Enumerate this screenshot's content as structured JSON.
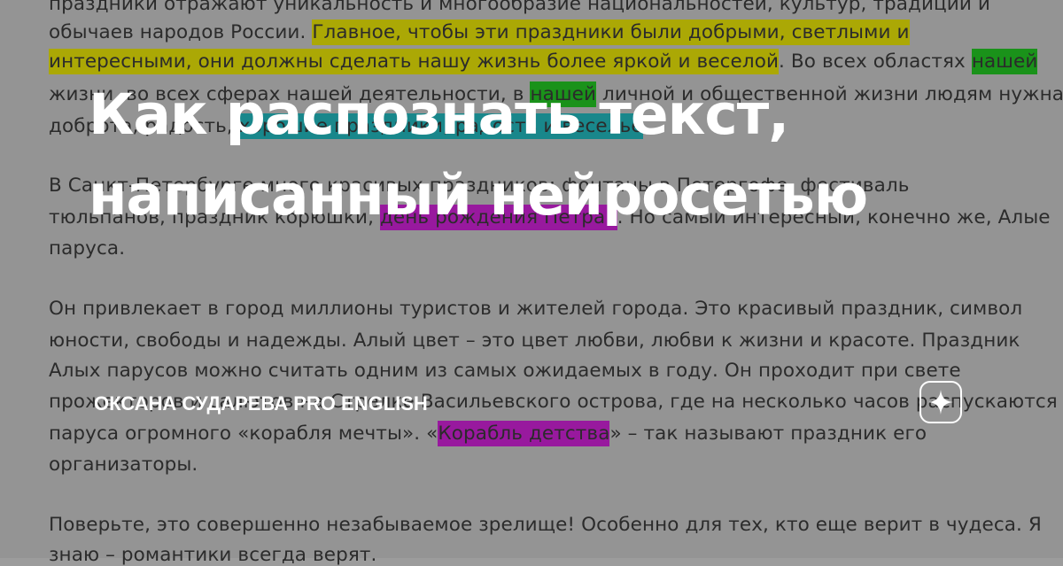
{
  "background_document": {
    "lines": [
      {
        "segments": [
          {
            "text": "праздники отражают уникальность и многообразие национальностей, культур, традиций и",
            "hl": ""
          }
        ]
      },
      {
        "segments": [
          {
            "text": "обычаев народов России. ",
            "hl": ""
          },
          {
            "text": "Главное, чтобы эти праздники были добрыми, светлыми и",
            "hl": "yellow"
          }
        ]
      },
      {
        "segments": [
          {
            "text": "интересными, они должны сделать нашу жизнь более яркой и веселой",
            "hl": "yellow"
          },
          {
            "text": ". Во всех областях ",
            "hl": ""
          },
          {
            "text": "нашей",
            "hl": "green"
          }
        ]
      },
      {
        "segments": [
          {
            "text": "жизни, во всех сферах нашей деятельности, в ",
            "hl": ""
          },
          {
            "text": "нашей",
            "hl": "green"
          },
          {
            "text": " личной и общественной жизни людям нужна",
            "hl": ""
          }
        ]
      },
      {
        "segments": [
          {
            "text": "доброта, радость, ",
            "hl": ""
          },
          {
            "text": "хорошие праздники, радость и веселье",
            "hl": "teal"
          },
          {
            "text": ".",
            "hl": ""
          }
        ]
      },
      {
        "segments": [
          {
            "text": "В Санкт-Петербурге много красивых праздников: фонтаны в Петергофе, фестиваль",
            "hl": ""
          }
        ]
      },
      {
        "segments": [
          {
            "text": "тюльпанов, праздник корюшки, ",
            "hl": ""
          },
          {
            "text": "день рождения Петра I",
            "hl": "purple"
          },
          {
            "text": ". Но самый интересный, конечно же, Алые",
            "hl": ""
          }
        ]
      },
      {
        "segments": [
          {
            "text": "паруса.",
            "hl": ""
          }
        ]
      },
      {
        "segments": [
          {
            "text": "Он привлекает в город миллионы туристов и жителей города. Это красивый праздник, символ",
            "hl": ""
          }
        ]
      },
      {
        "segments": [
          {
            "text": "юности, свободы и надежды. Алый цвет – это цвет любви, любви к жизни и красоте. Праздник",
            "hl": ""
          }
        ]
      },
      {
        "segments": [
          {
            "text": "Алых парусов можно считать одним из самых ожидаемых в году. Он проходит при свете",
            "hl": ""
          }
        ]
      },
      {
        "segments": [
          {
            "text": "прожекторов и салютов на Стрелке Васильевского острова, где на несколько часов распускаются",
            "hl": ""
          }
        ]
      },
      {
        "segments": [
          {
            "text": "паруса огромного «корабля мечты». «",
            "hl": ""
          },
          {
            "text": "Корабль детства",
            "hl": "purple"
          },
          {
            "text": "» – так называют праздник его",
            "hl": ""
          }
        ]
      },
      {
        "segments": [
          {
            "text": "организаторы.",
            "hl": ""
          }
        ]
      },
      {
        "segments": [
          {
            "text": "Поверьте, это совершенно незабываемое зрелище! Особенно для тех, кто еще верит в чудеса. Я",
            "hl": ""
          }
        ]
      },
      {
        "segments": [
          {
            "text": "знаю – романтики всегда верят.",
            "hl": ""
          }
        ]
      }
    ]
  },
  "title": {
    "line1": "Как распознать текст,",
    "line2": "написанный нейросетью"
  },
  "author": "ОКСАНА СУДАРЕВА PRO ENGLISH",
  "logo_icon": "sparkle-icon",
  "colors": {
    "highlight_yellow": "#b5b100",
    "highlight_green": "#179a17",
    "highlight_teal": "#168e92",
    "highlight_purple": "#a016a6"
  }
}
